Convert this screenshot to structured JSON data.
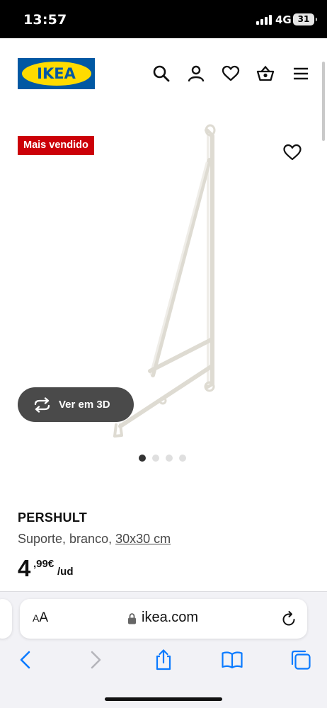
{
  "status_bar": {
    "time": "13:57",
    "network": "4G",
    "battery": "31"
  },
  "header": {
    "logo_text": "IKEA",
    "icons": [
      "search-icon",
      "user-icon",
      "heart-icon",
      "basket-icon",
      "menu-icon"
    ]
  },
  "product": {
    "badge": "Mais vendido",
    "name": "PERSHULT",
    "description": "Suporte, branco, ",
    "size": "30x30 cm",
    "price": {
      "integer": "4",
      "decimals": ",99€",
      "unit": "/ud"
    },
    "view_3d_label": "Ver em 3D",
    "carousel": {
      "total": 4,
      "active": 1
    }
  },
  "browser": {
    "text_size": {
      "small": "A",
      "large": "A"
    },
    "url": "ikea.com",
    "toolbar_icons": [
      "back-icon",
      "forward-icon",
      "share-icon",
      "bookmarks-icon",
      "tabs-icon"
    ]
  },
  "colors": {
    "ikea_blue": "#0058a3",
    "ikea_yellow": "#ffdb00",
    "badge_red": "#cc0008",
    "ios_blue": "#0a7aff"
  }
}
